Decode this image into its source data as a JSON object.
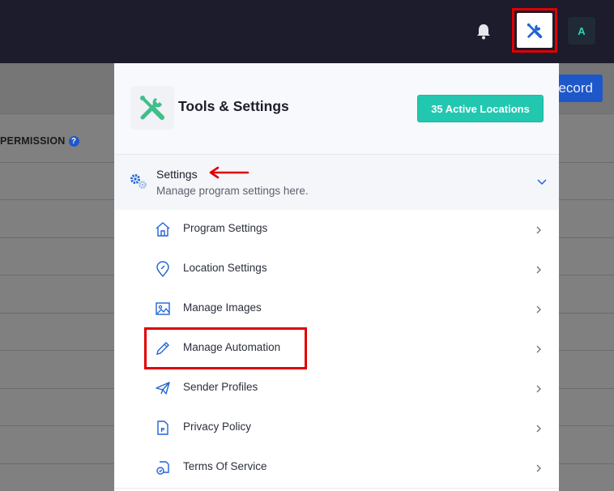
{
  "topbar": {
    "avatar_initial": "A",
    "bell_icon": "bell-icon",
    "tools_icon": "wrench-screwdriver-icon"
  },
  "background": {
    "record_button_label": "ecord",
    "permission_header": "PERMISSION",
    "help_glyph": "?"
  },
  "panel": {
    "title": "Tools & Settings",
    "active_locations_label": "35 Active Locations",
    "settings_section": {
      "title": "Settings",
      "subtitle": "Manage program settings here.",
      "icon": "gears-icon",
      "expanded": true
    },
    "items": [
      {
        "label": "Program Settings",
        "icon": "home-icon"
      },
      {
        "label": "Location Settings",
        "icon": "location-pin-icon"
      },
      {
        "label": "Manage Images",
        "icon": "image-icon"
      },
      {
        "label": "Manage Automation",
        "icon": "pencil-icon"
      },
      {
        "label": "Sender Profiles",
        "icon": "paper-plane-icon"
      },
      {
        "label": "Privacy Policy",
        "icon": "document-p-icon"
      },
      {
        "label": "Terms Of Service",
        "icon": "terms-icon"
      }
    ]
  },
  "colors": {
    "topbar": "#1c1c2d",
    "accent_teal": "#22c7b0",
    "highlight_red": "#e00000",
    "icon_blue": "#1e64d6"
  }
}
